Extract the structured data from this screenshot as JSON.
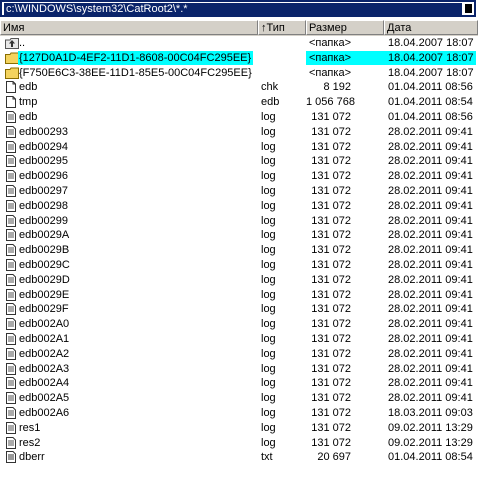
{
  "path": "c:\\WINDOWS\\system32\\CatRoot2\\*.*",
  "columns": {
    "name": "Имя",
    "type": "↑Тип",
    "size": "Размер",
    "date": "Дата"
  },
  "rows": [
    {
      "name": "..",
      "ext": "",
      "size": "<папка>",
      "date": "18.04.2007 18:07",
      "icon": "up-folder-icon",
      "selected": false
    },
    {
      "name": "{127D0A1D-4EF2-11D1-8608-00C04FC295EE}",
      "ext": "",
      "size": "<папка>",
      "date": "18.04.2007 18:07",
      "icon": "folder-icon",
      "selected": true
    },
    {
      "name": "{F750E6C3-38EE-11D1-85E5-00C04FC295EE}",
      "ext": "",
      "size": "<папка>",
      "date": "18.04.2007 18:07",
      "icon": "folder-icon",
      "selected": false
    },
    {
      "name": "edb",
      "ext": "chk",
      "size": "8 192",
      "date": "01.04.2011 08:56",
      "icon": "file-icon",
      "selected": false
    },
    {
      "name": "tmp",
      "ext": "edb",
      "size": "1 056 768",
      "date": "01.04.2011 08:54",
      "icon": "file-icon",
      "selected": false
    },
    {
      "name": "edb",
      "ext": "log",
      "size": "131 072",
      "date": "01.04.2011 08:56",
      "icon": "log-icon",
      "selected": false
    },
    {
      "name": "edb00293",
      "ext": "log",
      "size": "131 072",
      "date": "28.02.2011 09:41",
      "icon": "log-icon",
      "selected": false
    },
    {
      "name": "edb00294",
      "ext": "log",
      "size": "131 072",
      "date": "28.02.2011 09:41",
      "icon": "log-icon",
      "selected": false
    },
    {
      "name": "edb00295",
      "ext": "log",
      "size": "131 072",
      "date": "28.02.2011 09:41",
      "icon": "log-icon",
      "selected": false
    },
    {
      "name": "edb00296",
      "ext": "log",
      "size": "131 072",
      "date": "28.02.2011 09:41",
      "icon": "log-icon",
      "selected": false
    },
    {
      "name": "edb00297",
      "ext": "log",
      "size": "131 072",
      "date": "28.02.2011 09:41",
      "icon": "log-icon",
      "selected": false
    },
    {
      "name": "edb00298",
      "ext": "log",
      "size": "131 072",
      "date": "28.02.2011 09:41",
      "icon": "log-icon",
      "selected": false
    },
    {
      "name": "edb00299",
      "ext": "log",
      "size": "131 072",
      "date": "28.02.2011 09:41",
      "icon": "log-icon",
      "selected": false
    },
    {
      "name": "edb0029A",
      "ext": "log",
      "size": "131 072",
      "date": "28.02.2011 09:41",
      "icon": "log-icon",
      "selected": false
    },
    {
      "name": "edb0029B",
      "ext": "log",
      "size": "131 072",
      "date": "28.02.2011 09:41",
      "icon": "log-icon",
      "selected": false
    },
    {
      "name": "edb0029C",
      "ext": "log",
      "size": "131 072",
      "date": "28.02.2011 09:41",
      "icon": "log-icon",
      "selected": false
    },
    {
      "name": "edb0029D",
      "ext": "log",
      "size": "131 072",
      "date": "28.02.2011 09:41",
      "icon": "log-icon",
      "selected": false
    },
    {
      "name": "edb0029E",
      "ext": "log",
      "size": "131 072",
      "date": "28.02.2011 09:41",
      "icon": "log-icon",
      "selected": false
    },
    {
      "name": "edb0029F",
      "ext": "log",
      "size": "131 072",
      "date": "28.02.2011 09:41",
      "icon": "log-icon",
      "selected": false
    },
    {
      "name": "edb002A0",
      "ext": "log",
      "size": "131 072",
      "date": "28.02.2011 09:41",
      "icon": "log-icon",
      "selected": false
    },
    {
      "name": "edb002A1",
      "ext": "log",
      "size": "131 072",
      "date": "28.02.2011 09:41",
      "icon": "log-icon",
      "selected": false
    },
    {
      "name": "edb002A2",
      "ext": "log",
      "size": "131 072",
      "date": "28.02.2011 09:41",
      "icon": "log-icon",
      "selected": false
    },
    {
      "name": "edb002A3",
      "ext": "log",
      "size": "131 072",
      "date": "28.02.2011 09:41",
      "icon": "log-icon",
      "selected": false
    },
    {
      "name": "edb002A4",
      "ext": "log",
      "size": "131 072",
      "date": "28.02.2011 09:41",
      "icon": "log-icon",
      "selected": false
    },
    {
      "name": "edb002A5",
      "ext": "log",
      "size": "131 072",
      "date": "28.02.2011 09:41",
      "icon": "log-icon",
      "selected": false
    },
    {
      "name": "edb002A6",
      "ext": "log",
      "size": "131 072",
      "date": "18.03.2011 09:03",
      "icon": "log-icon",
      "selected": false
    },
    {
      "name": "res1",
      "ext": "log",
      "size": "131 072",
      "date": "09.02.2011 13:29",
      "icon": "log-icon",
      "selected": false
    },
    {
      "name": "res2",
      "ext": "log",
      "size": "131 072",
      "date": "09.02.2011 13:29",
      "icon": "log-icon",
      "selected": false
    },
    {
      "name": "dberr",
      "ext": "txt",
      "size": "20 697",
      "date": "01.04.2011 08:54",
      "icon": "text-file-icon",
      "selected": false
    }
  ],
  "colors": {
    "path_bg": "#0a246a",
    "selection": "#00ffff",
    "header_bg": "#d4d0c8",
    "folder_yellow": "#f4d35e"
  }
}
